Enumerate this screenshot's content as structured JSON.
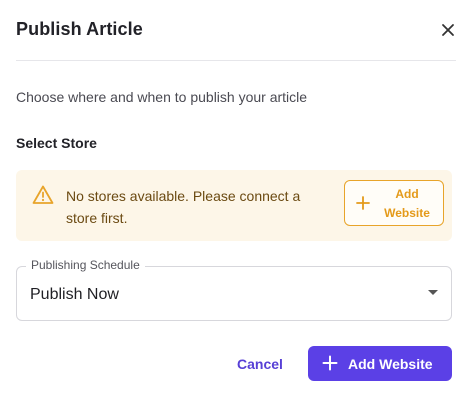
{
  "dialog": {
    "title": "Publish Article",
    "close_icon": "close-icon",
    "subtitle": "Choose where and when to publish your article"
  },
  "store": {
    "label": "Select Store",
    "alert": {
      "icon": "warning-icon",
      "message": "No stores available. Please connect a store first.",
      "button_line1": "Add",
      "button_line2": "Website",
      "button_icon": "plus-icon"
    }
  },
  "schedule": {
    "label": "Publishing Schedule",
    "selected": "Publish Now"
  },
  "footer": {
    "cancel_label": "Cancel",
    "primary_label": "Add Website",
    "primary_icon": "plus-icon"
  },
  "colors": {
    "accent": "#5b40e6",
    "warning": "#e8a42a",
    "warning_bg": "#fdf6e8"
  }
}
